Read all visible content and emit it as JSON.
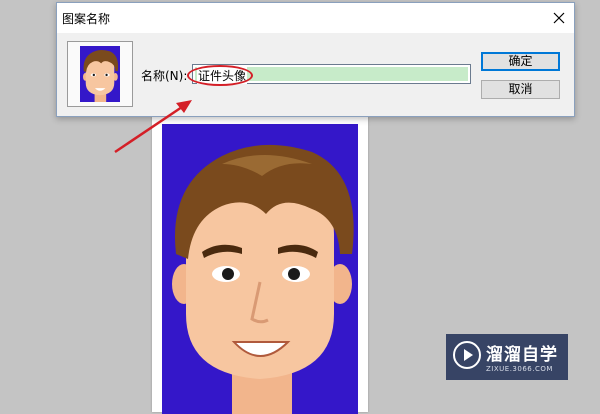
{
  "dialog": {
    "title": "图案名称",
    "name_label": "名称(N):",
    "name_value": "证件头像",
    "ok_label": "确定",
    "cancel_label": "取消"
  },
  "watermark": {
    "brand": "溜溜自学",
    "url": "ZIXUE.3066.COM"
  },
  "colors": {
    "portrait_background": "#3417c9",
    "annotation_red": "#d41f27",
    "input_selection": "#c7ebc9"
  },
  "icons": [
    "close-icon",
    "play-icon"
  ]
}
